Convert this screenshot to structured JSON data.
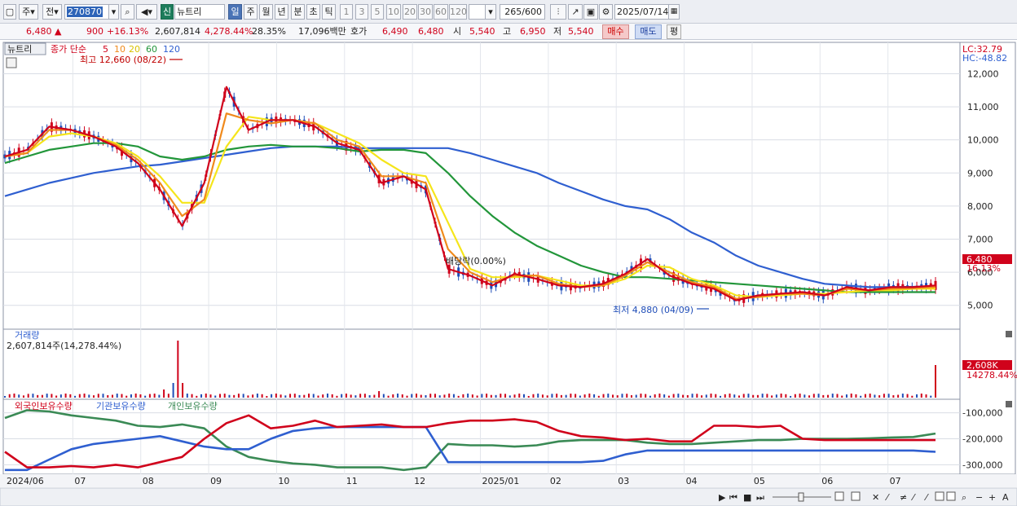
{
  "toolbar": {
    "item_type": "주",
    "market": "전",
    "code": "270870",
    "name_badge": "신",
    "stock_name": "뉴트리",
    "periods": [
      "일",
      "주",
      "월",
      "년",
      "분",
      "초",
      "틱"
    ],
    "selected_period": "일",
    "intervals": [
      "1",
      "3",
      "5",
      "10",
      "20",
      "30",
      "60",
      "120"
    ],
    "count": "265",
    "count_total": "/600",
    "date": "2025/07/14"
  },
  "quote": {
    "price": "6,480",
    "change": "900",
    "change_pct": "+16.13%",
    "volume": "2,607,814",
    "volume_ratio": "4,278.44%",
    "turnover": "28.35%",
    "amount": "17,096백만",
    "ask_label": "호가",
    "ask1": "6,490",
    "ask2": "6,480",
    "open_label": "시",
    "open": "5,540",
    "high_label": "고",
    "high": "6,950",
    "low_label": "저",
    "low": "5,540",
    "buy": "매수",
    "sell": "매도",
    "eval": "평"
  },
  "colors": {
    "up": "#d0021b",
    "down": "#1f4db8",
    "ma5": "#d0021b",
    "ma10": "#f08a1c",
    "ma20": "#f5e51b",
    "ma60": "#22963a",
    "ma120": "#2f5fd0",
    "foreign": "#d0021b",
    "institution": "#2f5fd0",
    "individual": "#3a8a55"
  },
  "chart_data": [
    {
      "type": "line",
      "panel": "price",
      "title": "뉴트리",
      "legend": [
        "종가 단순",
        "5",
        "10",
        "20",
        "60",
        "120"
      ],
      "lc": "LC:32.79",
      "hc": "HC:-48.82",
      "ylim": [
        4500,
        12800
      ],
      "yticks": [
        "12,000",
        "11,000",
        "10,000",
        "9,000",
        "8,000",
        "7,000",
        "6,000",
        "5,000"
      ],
      "x_labels": [
        "2024/06",
        "07",
        "08",
        "09",
        "10",
        "11",
        "12",
        "2025/01",
        "02",
        "03",
        "04",
        "05",
        "06",
        "07"
      ],
      "last_price": "6,480",
      "last_pct": "16.13%",
      "annotations": {
        "high": "최고 12,660 (08/22)",
        "low": "최저 4,880 (04/09)",
        "dividend": "배당락(0.00%)"
      },
      "series": [
        {
          "name": "5",
          "values": [
            9500,
            9700,
            10400,
            10300,
            10100,
            9800,
            9300,
            8500,
            7400,
            8700,
            11600,
            10300,
            10600,
            10600,
            10400,
            9900,
            9700,
            8700,
            8900,
            8500,
            6100,
            5900,
            5600,
            5950,
            5800,
            5600,
            5550,
            5650,
            5950,
            6400,
            5900,
            5650,
            5500,
            5150,
            5300,
            5350,
            5400,
            5300,
            5550,
            5450,
            5550,
            5550,
            5600
          ]
        },
        {
          "name": "10",
          "values": [
            9500,
            9600,
            10300,
            10300,
            10100,
            9850,
            9400,
            8700,
            7700,
            8200,
            10800,
            10600,
            10500,
            10600,
            10500,
            10000,
            9800,
            8900,
            8900,
            8700,
            6700,
            6000,
            5700,
            5900,
            5900,
            5650,
            5550,
            5600,
            5900,
            6300,
            6000,
            5700,
            5550,
            5200,
            5250,
            5350,
            5350,
            5300,
            5500,
            5450,
            5500,
            5520,
            5550
          ]
        },
        {
          "name": "20",
          "values": [
            9500,
            9600,
            10100,
            10200,
            10100,
            9900,
            9500,
            8900,
            8100,
            8100,
            9800,
            10700,
            10600,
            10600,
            10500,
            10200,
            9900,
            9400,
            9000,
            8900,
            7500,
            6100,
            5850,
            5850,
            5900,
            5750,
            5600,
            5600,
            5800,
            6200,
            6150,
            5800,
            5600,
            5300,
            5250,
            5300,
            5350,
            5350,
            5400,
            5450,
            5450,
            5500,
            5500
          ]
        },
        {
          "name": "60",
          "values": [
            9300,
            9500,
            9700,
            9800,
            9900,
            9900,
            9800,
            9500,
            9400,
            9500,
            9700,
            9800,
            9850,
            9800,
            9800,
            9750,
            9650,
            9700,
            9700,
            9600,
            9000,
            8300,
            7700,
            7200,
            6800,
            6500,
            6200,
            6000,
            5850,
            5850,
            5800,
            5750,
            5700,
            5650,
            5600,
            5550,
            5500,
            5450,
            5400,
            5400,
            5400,
            5400,
            5400
          ]
        },
        {
          "name": "120",
          "values": [
            8300,
            8500,
            8700,
            8850,
            9000,
            9100,
            9200,
            9250,
            9350,
            9450,
            9550,
            9650,
            9750,
            9800,
            9800,
            9800,
            9750,
            9750,
            9750,
            9750,
            9750,
            9600,
            9400,
            9200,
            9000,
            8700,
            8450,
            8200,
            8000,
            7900,
            7600,
            7200,
            6900,
            6500,
            6200,
            6000,
            5800,
            5650,
            5600,
            5550,
            5550,
            5560,
            5580
          ]
        }
      ]
    },
    {
      "type": "bar",
      "panel": "volume",
      "title": "거래량",
      "label": "2,607,814주(14,278.44%)",
      "last_value": "2,608K",
      "last_pct": "14278.44%"
    },
    {
      "type": "line",
      "panel": "holdings",
      "legend": [
        "외국인보유수량",
        "기관보유수량",
        "개인보유수량"
      ],
      "yticks": [
        "-100,000",
        "-200,000",
        "-300,000"
      ],
      "ylim": [
        -330000,
        -70000
      ],
      "series": [
        {
          "name": "외국인보유수량",
          "values": [
            -250000,
            -310000,
            -310000,
            -305000,
            -310000,
            -300000,
            -310000,
            -290000,
            -270000,
            -200000,
            -140000,
            -110000,
            -160000,
            -150000,
            -130000,
            -155000,
            -150000,
            -145000,
            -155000,
            -155000,
            -140000,
            -130000,
            -130000,
            -125000,
            -135000,
            -170000,
            -190000,
            -195000,
            -205000,
            -200000,
            -210000,
            -210000,
            -150000,
            -150000,
            -155000,
            -150000,
            -200000,
            -205000,
            -205000,
            -205000,
            -205000,
            -205000,
            -205000
          ]
        },
        {
          "name": "기관보유수량",
          "values": [
            -320000,
            -320000,
            -280000,
            -240000,
            -220000,
            -210000,
            -200000,
            -190000,
            -210000,
            -230000,
            -240000,
            -240000,
            -200000,
            -170000,
            -160000,
            -155000,
            -155000,
            -155000,
            -155000,
            -155000,
            -290000,
            -290000,
            -290000,
            -290000,
            -290000,
            -290000,
            -290000,
            -285000,
            -260000,
            -245000,
            -245000,
            -245000,
            -245000,
            -245000,
            -245000,
            -245000,
            -245000,
            -245000,
            -245000,
            -245000,
            -245000,
            -245000,
            -250000
          ]
        },
        {
          "name": "개인보유수량",
          "values": [
            -120000,
            -90000,
            -95000,
            -110000,
            -120000,
            -130000,
            -150000,
            -155000,
            -145000,
            -160000,
            -230000,
            -270000,
            -285000,
            -295000,
            -300000,
            -310000,
            -310000,
            -310000,
            -320000,
            -310000,
            -220000,
            -225000,
            -225000,
            -230000,
            -225000,
            -210000,
            -205000,
            -205000,
            -205000,
            -215000,
            -220000,
            -220000,
            -215000,
            -210000,
            -205000,
            -205000,
            -200000,
            -200000,
            -200000,
            -198000,
            -195000,
            -193000,
            -180000
          ]
        }
      ]
    }
  ],
  "bottom_icons": [
    "play-icon",
    "fast-back-icon",
    "stop-icon",
    "fast-forward-icon",
    "zoom-icon",
    "minus-icon",
    "plus-icon",
    "text-A-icon"
  ]
}
